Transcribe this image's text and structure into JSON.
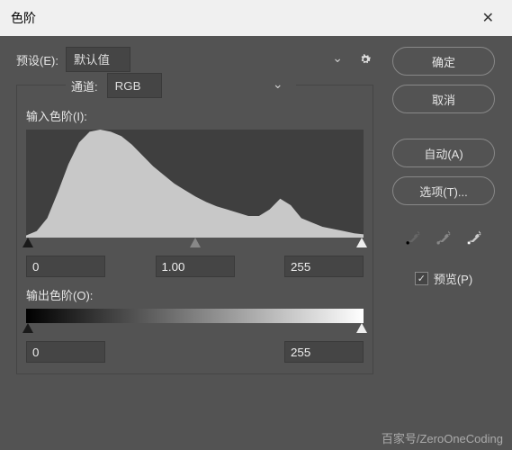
{
  "window": {
    "title": "色阶"
  },
  "preset": {
    "label": "预设(E):",
    "value": "默认值"
  },
  "channel": {
    "label": "通道:",
    "value": "RGB"
  },
  "input_levels": {
    "label": "输入色阶(I):",
    "shadow": "0",
    "gamma": "1.00",
    "highlight": "255"
  },
  "output_levels": {
    "label": "输出色阶(O):",
    "shadow": "0",
    "highlight": "255"
  },
  "buttons": {
    "ok": "确定",
    "cancel": "取消",
    "auto": "自动(A)",
    "options": "选项(T)..."
  },
  "preview": {
    "label": "预览(P)",
    "checked": true
  },
  "watermark": "百家号/ZeroOneCoding",
  "chart_data": {
    "type": "area",
    "title": "",
    "xlabel": "",
    "ylabel": "",
    "xlim": [
      0,
      255
    ],
    "ylim": [
      0,
      100
    ],
    "x": [
      0,
      8,
      16,
      24,
      32,
      40,
      48,
      56,
      64,
      72,
      80,
      88,
      96,
      104,
      112,
      120,
      128,
      136,
      144,
      152,
      160,
      168,
      176,
      184,
      192,
      200,
      208,
      216,
      224,
      232,
      240,
      248,
      255
    ],
    "values": [
      2,
      6,
      18,
      42,
      68,
      88,
      98,
      100,
      98,
      94,
      86,
      76,
      66,
      58,
      50,
      44,
      38,
      33,
      29,
      26,
      23,
      20,
      20,
      26,
      36,
      30,
      18,
      14,
      10,
      8,
      6,
      4,
      3
    ]
  }
}
